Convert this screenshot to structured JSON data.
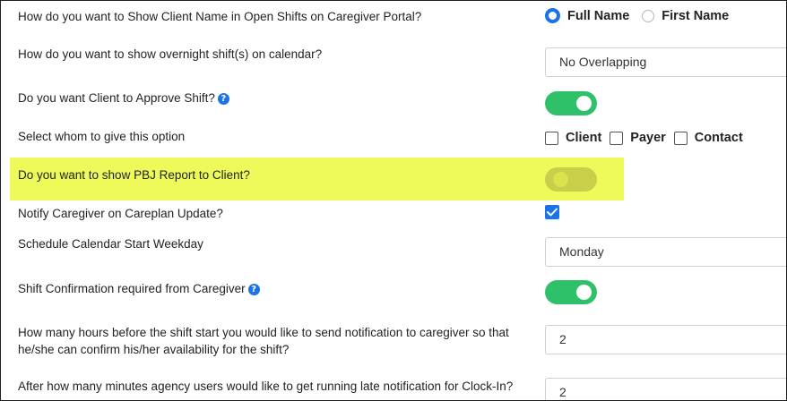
{
  "settings": {
    "client_name": {
      "question": "How do you want to Show Client Name in Open Shifts on Caregiver Portal?",
      "options": [
        "Full Name",
        "First Name"
      ],
      "selected": "Full Name"
    },
    "overnight": {
      "question": "How do you want to show overnight shift(s) on calendar?",
      "value": "No Overlapping"
    },
    "client_approve": {
      "question": "Do you want Client to Approve Shift?",
      "help_icon": "question-circle-icon",
      "enabled": true
    },
    "whom": {
      "question": "Select whom to give this option",
      "options": [
        "Client",
        "Payer",
        "Contact"
      ]
    },
    "pbj_report": {
      "question": "Do you want to show PBJ Report to Client?",
      "enabled": false
    },
    "notify_careplan": {
      "question": "Notify Caregiver on Careplan Update?",
      "checked": true
    },
    "calendar_start": {
      "question": "Schedule Calendar Start Weekday",
      "value": "Monday"
    },
    "shift_confirmation": {
      "question": "Shift Confirmation required from Caregiver",
      "help_icon": "question-circle-icon",
      "enabled": true
    },
    "notify_hours": {
      "question_line1": "How many hours before the shift start you would like to send notification to caregiver so that",
      "question_line2": "he/she can confirm his/her availability for the shift?",
      "value": "2"
    },
    "late_minutes": {
      "question": "After how many minutes agency users would like to get running late notification for Clock-In?",
      "value": "2"
    }
  },
  "colors": {
    "accent": "#1a73e8",
    "toggle_on": "#2fc16a",
    "highlight": "#eefa5a"
  }
}
